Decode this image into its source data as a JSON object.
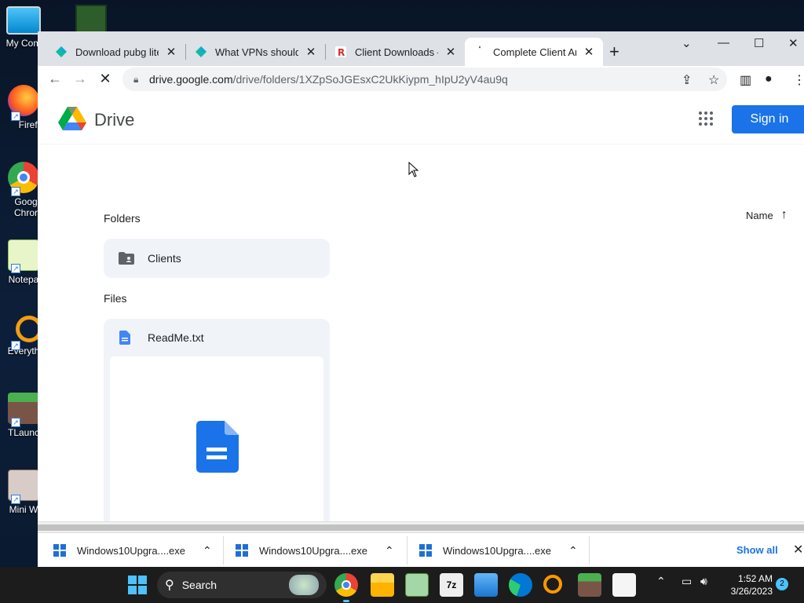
{
  "desktop": {
    "icons": [
      {
        "label": "My Com"
      },
      {
        "label": "Firefo"
      },
      {
        "label": "Goog\nChror"
      },
      {
        "label": "Notepa"
      },
      {
        "label": "Everyth"
      },
      {
        "label": "TLaunc"
      },
      {
        "label": "Mini W"
      }
    ]
  },
  "browser": {
    "tabs": [
      {
        "title": "Download pubg lite",
        "close": "✕"
      },
      {
        "title": "What VPNs should yo",
        "close": "✕"
      },
      {
        "title": "Client Downloads — ",
        "close": "✕"
      },
      {
        "title": "Complete Client Arch",
        "close": "✕"
      }
    ],
    "new_tab": "+",
    "url_host": "drive.google.com",
    "url_path": "/drive/folders/1XZpSoJGEsxC2UkKiypm_hIpU2yV4au9q"
  },
  "drive": {
    "brand": "Drive",
    "sign_in": "Sign in",
    "folders_label": "Folders",
    "files_label": "Files",
    "sort_label": "Name",
    "sort_arrow": "↑",
    "folders": [
      {
        "name": "Clients"
      }
    ],
    "files": [
      {
        "name": "ReadMe.txt"
      }
    ]
  },
  "downloads": {
    "items": [
      {
        "name": "Windows10Upgra....exe"
      },
      {
        "name": "Windows10Upgra....exe"
      },
      {
        "name": "Windows10Upgra....exe"
      }
    ],
    "show_all": "Show all"
  },
  "taskbar": {
    "search_placeholder": "Search",
    "time": "1:52 AM",
    "date": "3/26/2023",
    "notifications": "2"
  },
  "colors": {
    "accent": "#1a73e8",
    "taskbar": "#1c1c1c",
    "tab_bar": "#dee1e6"
  }
}
